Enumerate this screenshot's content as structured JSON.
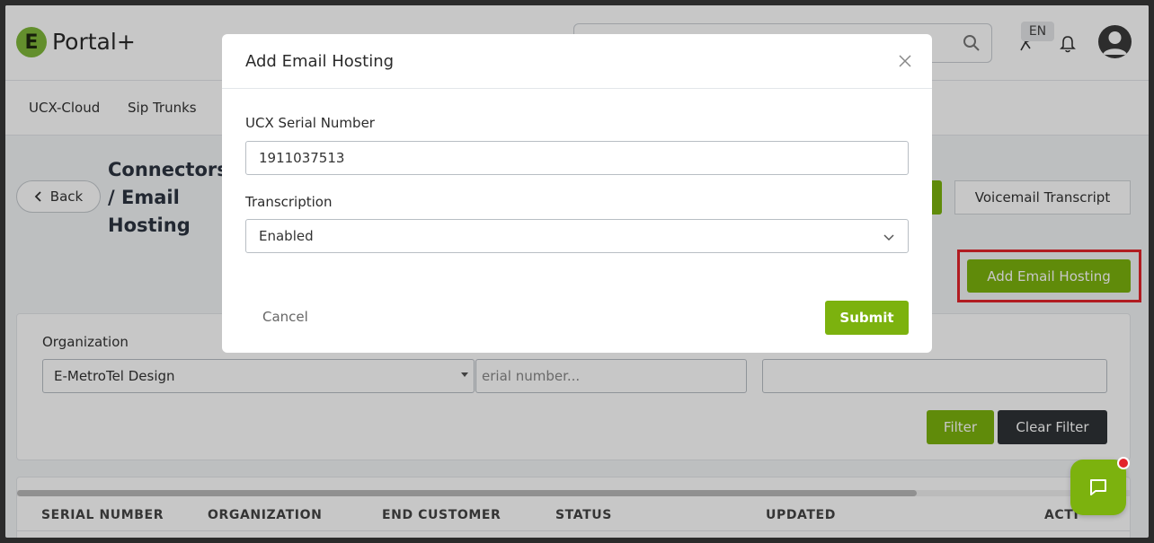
{
  "header": {
    "logo_letter": "E",
    "logo_text": "Portal+",
    "language": "EN"
  },
  "nav": {
    "items": [
      {
        "label": "UCX-Cloud"
      },
      {
        "label": "Sip Trunks"
      }
    ]
  },
  "page": {
    "back_label": "Back",
    "title": "Connectors / Email Hosting",
    "voicemail_button": "Voicemail Transcript",
    "add_button": "Add Email Hosting"
  },
  "filter": {
    "org_label": "Organization",
    "org_value": "E-MetroTel Design",
    "serial_placeholder": "erial number...",
    "filter_button": "Filter",
    "clear_button": "Clear Filter"
  },
  "table": {
    "columns": [
      "SERIAL NUMBER",
      "ORGANIZATION",
      "END CUSTOMER",
      "STATUS",
      "UPDATED",
      "ACTI"
    ]
  },
  "modal": {
    "title": "Add Email Hosting",
    "serial_label": "UCX Serial Number",
    "serial_value": "1911037513",
    "transcription_label": "Transcription",
    "transcription_value": "Enabled",
    "cancel_label": "Cancel",
    "submit_label": "Submit"
  },
  "colors": {
    "accent": "#7cb20e",
    "highlight": "#e3242b",
    "dark": "#2f3336"
  }
}
